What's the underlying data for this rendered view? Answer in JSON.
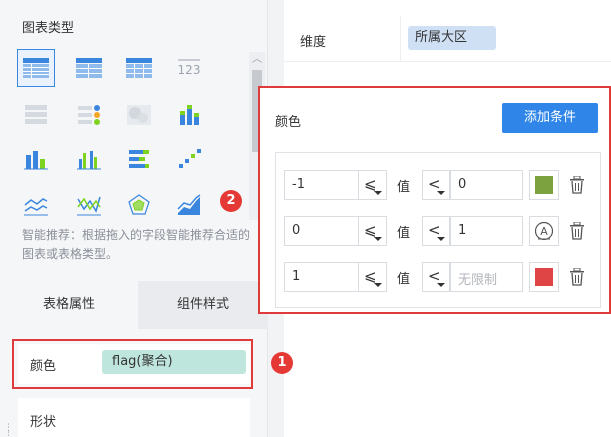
{
  "left_panel": {
    "chart_type_title": "图表类型",
    "chart_icons": [
      {
        "name": "table-group-icon",
        "selected": true
      },
      {
        "name": "table-cross-icon"
      },
      {
        "name": "table-detail-icon"
      },
      {
        "name": "number-kpi-icon",
        "text": "123"
      },
      {
        "name": "list-card-icon"
      },
      {
        "name": "dot-list-icon"
      },
      {
        "name": "map-blur-icon"
      },
      {
        "name": "stacked-bar-icon"
      },
      {
        "name": "bar-chart-icon"
      },
      {
        "name": "grouped-bar-icon"
      },
      {
        "name": "horizontal-bar-icon"
      },
      {
        "name": "scatter-step-icon"
      },
      {
        "name": "line-chart-icon"
      },
      {
        "name": "zigzag-line-icon"
      },
      {
        "name": "radar-chart-icon"
      },
      {
        "name": "area-chart-icon"
      }
    ],
    "hint": "智能推荐：根据拖入的字段智能推荐合适的图表或表格类型。",
    "tabs": {
      "table_props": "表格属性",
      "component_style": "组件样式"
    },
    "color_label": "颜色",
    "color_field": "flag(聚合)",
    "shape_label": "形状"
  },
  "right_panel": {
    "dimension_label": "维度",
    "dimension_field": "所属大区"
  },
  "color_dialog": {
    "title": "颜色",
    "add_button": "添加条件",
    "value_label": "值",
    "conditions": [
      {
        "min": "-1",
        "op1": "⩽",
        "op2": "<",
        "max": "0",
        "max_placeholder": false,
        "swatch": "#7ba23f",
        "swatch_type": "color"
      },
      {
        "min": "0",
        "op1": "⩽",
        "op2": "<",
        "max": "1",
        "max_placeholder": false,
        "swatch": "auto",
        "swatch_type": "auto"
      },
      {
        "min": "1",
        "op1": "⩽",
        "op2": "<",
        "max": "无限制",
        "max_placeholder": true,
        "swatch": "#e04545",
        "swatch_type": "color"
      }
    ]
  },
  "annotations": {
    "badge1": "1",
    "badge2": "2",
    "highlight_color": "#e03b3b"
  },
  "colors": {
    "accent": "#2f86e8",
    "pill_green": "#bfe6dc",
    "pill_blue": "#cfe0f5"
  }
}
